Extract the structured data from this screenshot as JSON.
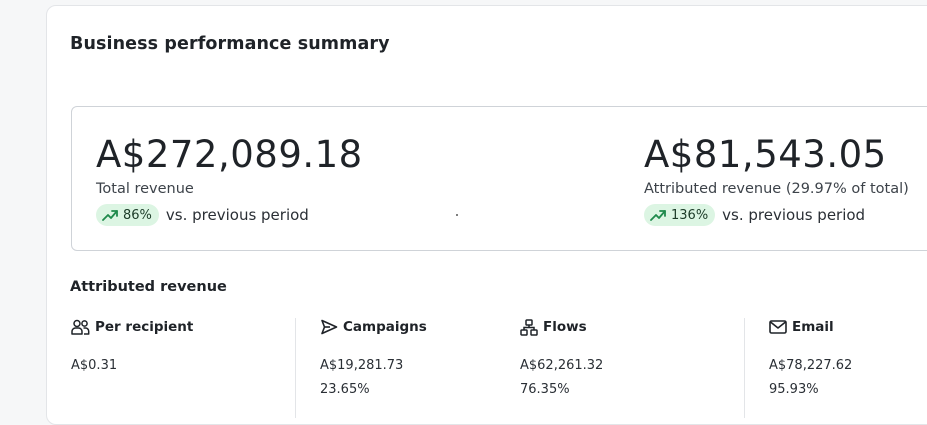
{
  "page": {
    "title": "Business performance summary"
  },
  "summary": {
    "total": {
      "amount": "A$272,089.18",
      "label": "Total revenue",
      "change": "86%",
      "change_suffix": "vs. previous period",
      "trend_icon": "trending-up-icon"
    },
    "attributed": {
      "amount": "A$81,543.05",
      "label": "Attributed revenue (29.97% of total)",
      "change": "136%",
      "change_suffix": "vs. previous period",
      "trend_icon": "trending-up-icon"
    }
  },
  "attributed_revenue": {
    "title": "Attributed revenue",
    "columns": [
      {
        "icon": "users-icon",
        "label": "Per recipient",
        "value": "A$0.31",
        "percent": ""
      },
      {
        "icon": "send-icon",
        "label": "Campaigns",
        "value": "A$19,281.73",
        "percent": "23.65%"
      },
      {
        "icon": "flows-icon",
        "label": "Flows",
        "value": "A$62,261.32",
        "percent": "76.35%"
      },
      {
        "icon": "mail-icon",
        "label": "Email",
        "value": "A$78,227.62",
        "percent": "95.93%"
      }
    ]
  },
  "colors": {
    "positive_pill_bg": "#dcf5e3",
    "positive_icon": "#1f8a4c",
    "border": "#cfd3d8"
  }
}
